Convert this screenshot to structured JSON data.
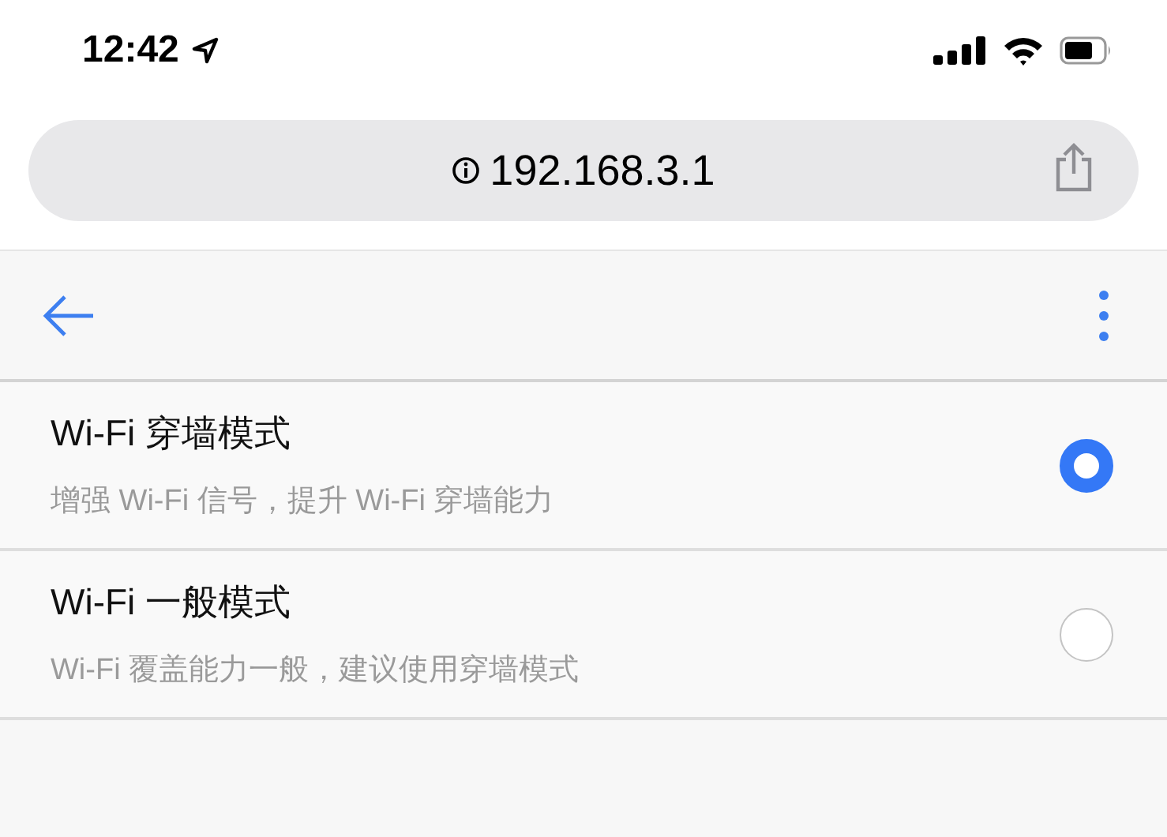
{
  "status_bar": {
    "time": "12:42"
  },
  "address_bar": {
    "url": "192.168.3.1"
  },
  "options": [
    {
      "title": "Wi-Fi 穿墙模式",
      "subtitle": "增强 Wi-Fi 信号，提升 Wi-Fi 穿墙能力",
      "selected": true
    },
    {
      "title": "Wi-Fi 一般模式",
      "subtitle": "Wi-Fi 覆盖能力一般，建议使用穿墙模式",
      "selected": false
    }
  ]
}
